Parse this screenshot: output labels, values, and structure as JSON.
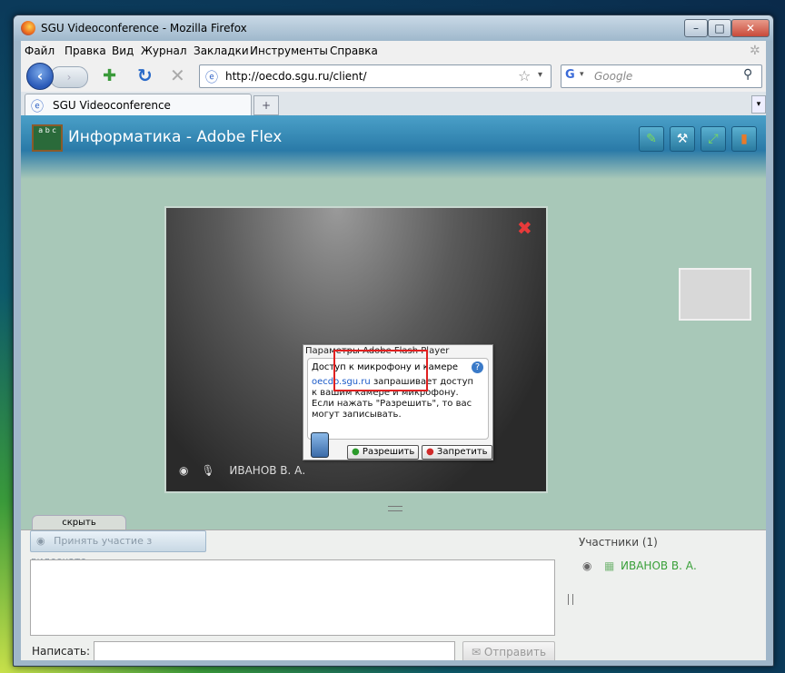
{
  "window": {
    "title": "SGU Videoconference - Mozilla Firefox",
    "controls": [
      "–",
      "□",
      "✕"
    ]
  },
  "menu": [
    "Файл",
    "Правка",
    "Вид",
    "Журнал",
    "Закладки",
    "Инструменты",
    "Справка"
  ],
  "nav": {
    "url": "http://oecdo.sgu.ru/client/",
    "search_placeholder": "Google"
  },
  "tabs": [
    {
      "label": "SGU Videoconference"
    }
  ],
  "app": {
    "title": "Информатика - Adobe Flex",
    "logo_text": "a b c"
  },
  "video": {
    "user_name": "ИВАНОВ В. А."
  },
  "flash_dialog": {
    "title": "Параметры Adobe Flash Player",
    "heading": "Доступ к микрофону и камере",
    "domain": "oecdo.sgu.ru",
    "message": "запрашивает доступ к вашим камере и микрофону. Если нажать \"Разрешить\", то вас могут записывать.",
    "allow_label": "Разрешить",
    "deny_label": "Запретить"
  },
  "panel": {
    "hide_tab": "скрыть",
    "join_video_label": "Принять участие з видеочате",
    "write_label": "Написать:",
    "send_label": "Отправить",
    "participants_title": "Участники (1)",
    "participants": [
      {
        "name": "ИВАНОВ В. А."
      }
    ]
  },
  "colors": {
    "header_blue": "#2a7aa8",
    "page_green": "#a8c8b8",
    "highlight_red": "#e02020",
    "participant_green": "#3aa03a"
  }
}
